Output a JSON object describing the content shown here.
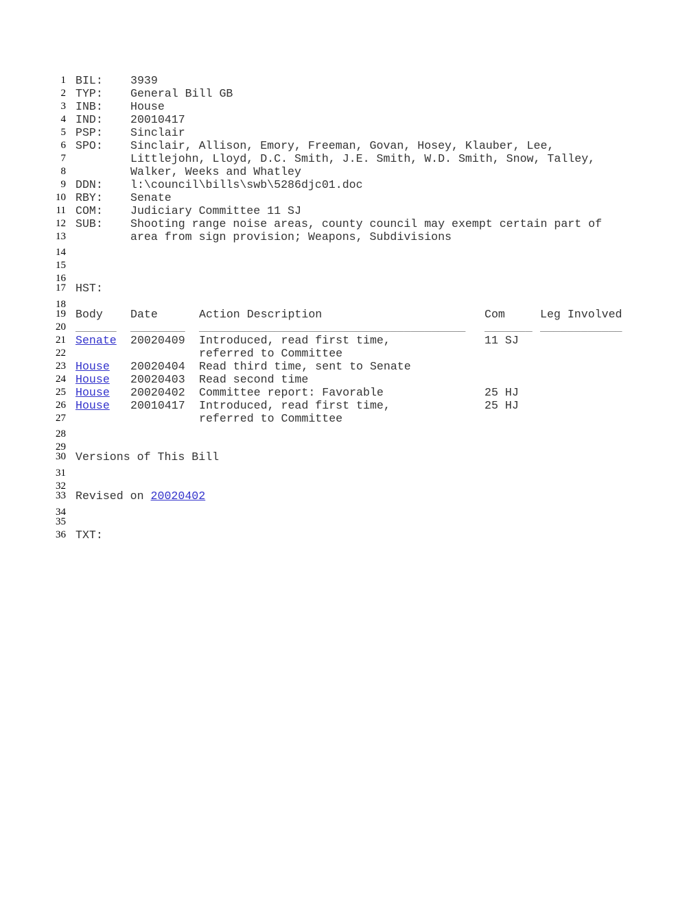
{
  "bill_info": {
    "fields": [
      {
        "line": "1",
        "label": "BIL:",
        "value": "3939"
      },
      {
        "line": "2",
        "label": "TYP:",
        "value": "General Bill GB"
      },
      {
        "line": "3",
        "label": "INB:",
        "value": "House"
      },
      {
        "line": "4",
        "label": "IND:",
        "value": "20010417"
      },
      {
        "line": "5",
        "label": "PSP:",
        "value": "Sinclair"
      },
      {
        "line": "6",
        "label": "SPO:",
        "value": "Sinclair, Allison, Emory, Freeman, Govan, Hosey, Klauber, Lee,"
      },
      {
        "line": "7",
        "label": "",
        "value": "Littlejohn, Lloyd, D.C. Smith, J.E. Smith, W.D. Smith, Snow, Talley,"
      },
      {
        "line": "8",
        "label": "",
        "value": "Walker, Weeks and Whatley"
      },
      {
        "line": "9",
        "label": "DDN:",
        "value": "l:\\council\\bills\\swb\\5286djc01.doc"
      },
      {
        "line": "10",
        "label": "RBY:",
        "value": "Senate"
      },
      {
        "line": "11",
        "label": "COM:",
        "value": "Judiciary Committee 11 SJ"
      },
      {
        "line": "12",
        "label": "SUB:",
        "value": "Shooting range noise areas, county council may exempt certain part of"
      },
      {
        "line": "13",
        "label": "",
        "value": "area from sign provision; Weapons, Subdivisions"
      }
    ]
  },
  "blank_lines": [
    "14",
    "15",
    "16",
    "18",
    "20",
    "28",
    "29",
    "31",
    "32",
    "34",
    "35"
  ],
  "history": {
    "line": "17",
    "label": "HST:",
    "header_line": "19",
    "columns": {
      "body": "Body",
      "date": "Date",
      "action": "Action Description",
      "com": "Com",
      "leg": "Leg Involved"
    },
    "underline_line": "20",
    "underlines": {
      "body": "______",
      "date": "________",
      "action": "_______________________________________",
      "com": "_______",
      "leg": "____________"
    },
    "rows": [
      {
        "line": "21",
        "body": "Senate",
        "date": "20020409",
        "action": "Introduced, read first time,",
        "com": "11 SJ",
        "leg": ""
      },
      {
        "line": "22",
        "body": "",
        "date": "",
        "action": "referred to Committee",
        "com": "",
        "leg": ""
      },
      {
        "line": "23",
        "body": "House",
        "date": "20020404",
        "action": "Read third time, sent to Senate",
        "com": "",
        "leg": ""
      },
      {
        "line": "24",
        "body": "House",
        "date": "20020403",
        "action": "Read second time",
        "com": "",
        "leg": ""
      },
      {
        "line": "25",
        "body": "House",
        "date": "20020402",
        "action": "Committee report: Favorable",
        "com": "25 HJ",
        "leg": ""
      },
      {
        "line": "26",
        "body": "House",
        "date": "20010417",
        "action": "Introduced, read first time,",
        "com": "25 HJ",
        "leg": ""
      },
      {
        "line": "27",
        "body": "",
        "date": "",
        "action": "referred to Committee",
        "com": "",
        "leg": ""
      }
    ]
  },
  "versions": {
    "line": "30",
    "title": "Versions of This Bill",
    "revised_line": "33",
    "revised_prefix": "Revised on ",
    "revised_link": "20020402"
  },
  "text_section": {
    "line": "36",
    "label": "TXT:"
  },
  "colors": {
    "link": "#3333cc",
    "text": "#333333"
  }
}
